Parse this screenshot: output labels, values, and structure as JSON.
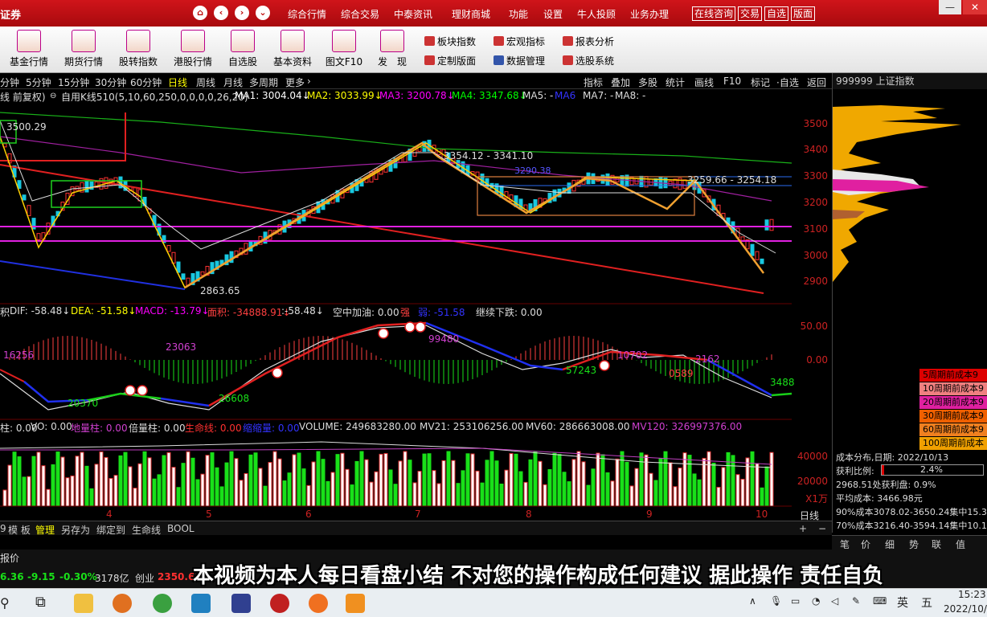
{
  "titlebar": {
    "logo": "证券",
    "nav_icons": [
      "home-icon",
      "back-icon",
      "forward-icon",
      "dropdown-icon"
    ],
    "menu": [
      "综合行情",
      "综合交易",
      "中泰资讯",
      "理财商城",
      "功能",
      "设置",
      "牛人投顾",
      "业务办理"
    ],
    "boxed": [
      "在线咨询",
      "交易",
      "自选",
      "版面"
    ]
  },
  "toolbar": {
    "big": [
      "基金行情",
      "期货行情",
      "股转指数",
      "港股行情",
      "自选股",
      "基本资料",
      "图文F10",
      "发　现"
    ],
    "small": [
      "板块指数",
      "宏观指标",
      "报表分析",
      "定制版面",
      "数据管理",
      "选股系统"
    ]
  },
  "periods": [
    "分钟",
    "5分钟",
    "15分钟",
    "30分钟",
    "60分钟",
    "日线",
    "周线",
    "月线",
    "多周期",
    "更多"
  ],
  "right_buttons": [
    "指标",
    "叠加",
    "多股",
    "统计",
    "画线",
    "F10",
    "标记",
    "·自选",
    "返回"
  ],
  "indicator_line": {
    "prefix": "线 前复权)",
    "main": "自用K线510(5,10,60,250,0,0,0,0,26,20)",
    "ma1": "MA1: 3004.04↓",
    "ma2": "MA2: 3033.99↓",
    "ma3": "MA3: 3200.78↓",
    "ma4": "MA4: 3347.68↓",
    "ma5": "MA5: -",
    "ma6": "MA6",
    "ma7": "MA7: -",
    "ma8": "MA8: -"
  },
  "chart_labels": {
    "top_left": "3500.29",
    "low": "2863.65",
    "peak": "3354.12 - 3341.10",
    "mid": "3290.38",
    "right": "3259.66 - 3254.18"
  },
  "price_axis": [
    "3500",
    "3400",
    "3300",
    "3200",
    "3100",
    "3000",
    "2900"
  ],
  "macd_line": {
    "dif": "DIF: -58.48↓",
    "dea": "DEA: -51.58↓",
    "macd": "MACD: -13.79↓",
    "area": "面积: -34888.91↓",
    "v": ":-58.48↓",
    "kong": "空中加油: 0.00",
    "qiang": "强",
    "ruo": "弱: -51.58",
    "xd": "继续下跌: 0.00",
    "prefix": "积"
  },
  "macd_axis": [
    "50.00",
    "0.00"
  ],
  "macd_labels": [
    "16256",
    "23063",
    "99480",
    "10702",
    "2162",
    "0589",
    "57243",
    "3488",
    "26608",
    "20370"
  ],
  "vol_line": {
    "a": "柱: 0.00",
    "vo": "VO: 0.00",
    "dl": "地量柱: 0.00",
    "bl": "倍量柱: 0.00",
    "sm": "生命线: 0.00",
    "ss": "缩缩量: 0.00",
    "volume": "VOLUME: 249683280.00",
    "mv21": "MV21: 253106256.00",
    "mv60": "MV60: 286663008.00",
    "mv120": "MV120: 326997376.00"
  },
  "vol_axis": [
    "40000",
    "20000"
  ],
  "vol_unit": "X1万",
  "date_ticks": [
    "4",
    "5",
    "6",
    "7",
    "8",
    "9",
    "10"
  ],
  "bottom_tabs": [
    "9",
    "模 板",
    "管理",
    "另存为",
    "绑定到",
    "生命线",
    "BOOL"
  ],
  "side": {
    "title": "999999 上证指数",
    "costs": [
      "5周期前成本9",
      "10周期前成本9",
      "20周期前成本9",
      "30周期前成本9",
      "60周期前成本9",
      "100周期前成本"
    ],
    "dist_date": "成本分布,日期:  2022/10/13",
    "profit_label": "获利比例:",
    "profit_pct": "2.4%",
    "profit_line": "2968.51处获利盘:  0.9%",
    "avg_cost": "平均成本:  3466.98元",
    "c90": "90%成本3078.02-3650.24集中15.3",
    "c70": "70%成本3216.40-3594.14集中10.1",
    "period_label": "日线",
    "tabs": [
      "笔",
      "价",
      "细",
      "势",
      "联",
      "值"
    ]
  },
  "status": {
    "report": "报价",
    "v1": "6.36",
    "v2": "-9.15",
    "v3": "-0.30%",
    "v4": "3178亿",
    "cy": "创业",
    "cyv": "2350.69"
  },
  "caption": "本视频为本人每日看盘小结 不对您的操作构成任何建议 据此操作 责任自负",
  "taskbar": {
    "time": "15:23",
    "date": "2022/10/",
    "ime": "英",
    "ime2": "五"
  },
  "colors": {
    "up": "#ff3232",
    "down": "#00e600",
    "accent": "#d0141a"
  }
}
